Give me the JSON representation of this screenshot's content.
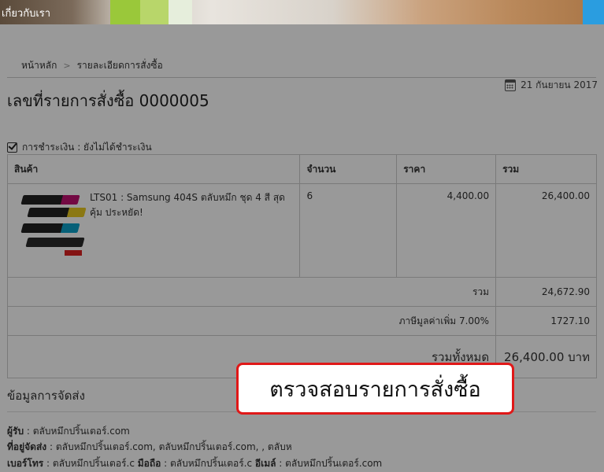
{
  "banner": {
    "link": "เกี่ยวกับเรา"
  },
  "breadcrumb": {
    "home": "หน้าหลัก",
    "current": "รายละเอียดการสั่งซื้อ"
  },
  "order": {
    "title": "เลขที่รายการสั่งซื้อ 0000005",
    "date": "21 กันยายน 2017",
    "payment_status": "การชำระเงิน : ยังไม่ได้ชำระเงิน"
  },
  "table": {
    "headers": {
      "product": "สินค้า",
      "qty": "จำนวน",
      "price": "ราคา",
      "total": "รวม"
    },
    "item": {
      "name": "LTS01 : Samsung 404S ตลับหมึก ชุด 4 สี สุดคุ้ม ประหยัด!",
      "qty": "6",
      "price": "4,400.00",
      "total": "26,400.00"
    },
    "subtotal_label": "รวม",
    "subtotal_value": "24,672.90",
    "vat_label": "ภาษีมูลค่าเพิ่ม 7.00%",
    "vat_value": "1727.10",
    "grand_label": "รวมทั้งหมด",
    "grand_value": "26,400.00 บาท"
  },
  "shipping": {
    "title": "ข้อมูลการจัดส่ง",
    "recipient_label": "ผู้รับ",
    "recipient_value": " : ตลับหมึกปริ้นเตอร์.com",
    "address_label": "ที่อยู่จัดส่ง",
    "address_value": " : ตลับหมึกปริ้นเตอร์.com, ตลับหมึกปริ้นเตอร์.com, , ตลับห",
    "phone_label": "เบอร์โทร",
    "phone_value": " : ตลับหมึกปริ้นเตอร์.c ",
    "mobile_label": "มือถือ",
    "mobile_value": " : ตลับหมึกปริ้นเตอร์.c ",
    "email_label": "อีเมล์",
    "email_value": " : ตลับหมึกปริ้นเตอร์.com"
  },
  "callout": {
    "text": "ตรวจสอบรายการสั่งซื้อ"
  },
  "colors": {
    "overlay": "#000000",
    "callout_border": "#e01818"
  }
}
